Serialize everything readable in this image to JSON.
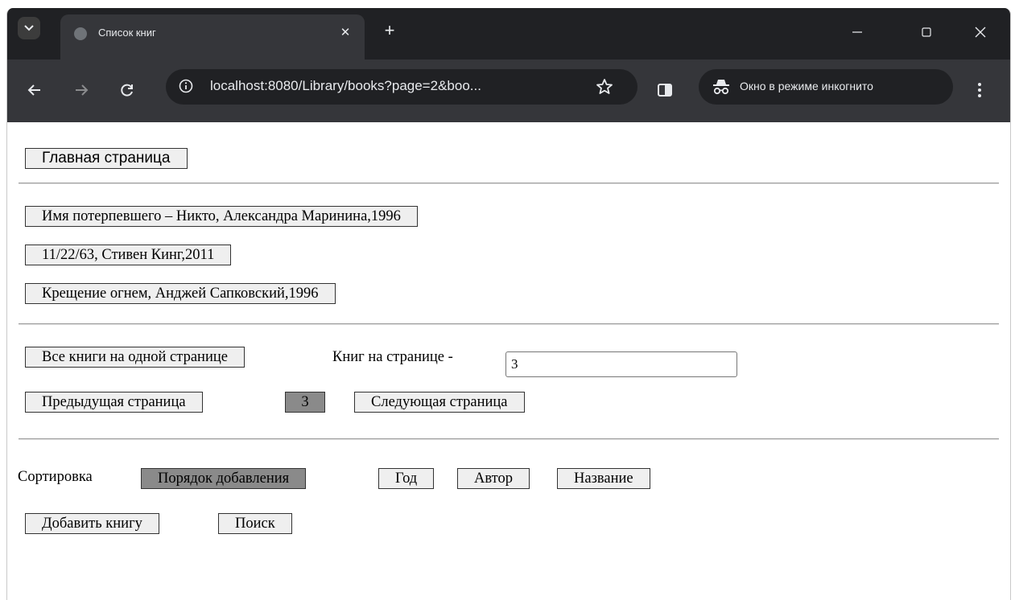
{
  "browser": {
    "tab_title": "Список книг",
    "url": "localhost:8080/Library/books?page=2&boo...",
    "incognito_label": "Окно в режиме инкогнито",
    "colors": {
      "frame": "#202124",
      "toolbar": "#35363a",
      "text": "#e8eaed"
    }
  },
  "page": {
    "home_button": "Главная страница",
    "books": [
      "Имя потерпевшего – Никто, Александра Маринина,1996",
      "11/22/63, Стивен Кинг,2011",
      "Крещение огнем, Анджей Сапковский,1996"
    ],
    "all_books_button": "Все книги на одной странице",
    "per_page_label": "Книг на странице -",
    "per_page_value": "3",
    "prev_page_button": "Предыдущая страница",
    "current_page": "3",
    "next_page_button": "Следующая страница",
    "sort_label": "Сортировка",
    "sort_options": [
      "Порядок добавления",
      "Год",
      "Автор",
      "Название"
    ],
    "active_sort": "Порядок добавления",
    "add_book_button": "Добавить книгу",
    "search_button": "Поиск",
    "colors": {
      "active_button": "#8a8a8a",
      "button": "#efefef"
    }
  }
}
